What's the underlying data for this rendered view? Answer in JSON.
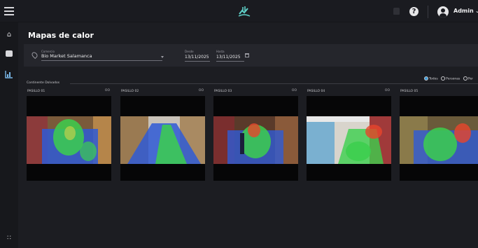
{
  "header": {
    "user_name": "Admin"
  },
  "page": {
    "title": "Mapas de calor"
  },
  "filters": {
    "store_label": "Comercio",
    "store_value": "Bio Market Salamanca",
    "from_label": "Desde",
    "from_value": "13/11/2025",
    "to_label": "Hasta",
    "to_value": "13/11/2025"
  },
  "options": {
    "items": [
      {
        "label": "Todos",
        "selected": true
      },
      {
        "label": "Personas",
        "selected": false
      },
      {
        "label": "Per",
        "selected": false
      }
    ]
  },
  "section": {
    "label": "Continente Dolvados"
  },
  "cameras": [
    {
      "name": "PASILLO 01",
      "flag": "OO"
    },
    {
      "name": "PASILLO 02",
      "flag": "OO"
    },
    {
      "name": "PASILLO 03",
      "flag": "OO"
    },
    {
      "name": "PASILLO 04",
      "flag": "OO"
    },
    {
      "name": "PASILLO 05",
      "flag": ""
    }
  ],
  "colors": {
    "accent": "#3a9bd9",
    "heat_low": "#2f5bd6",
    "heat_mid": "#3ccf4e",
    "heat_high": "#e8452c"
  },
  "icons": {
    "menu": "hamburger-icon",
    "logo": "brand-logo-icon",
    "bell": "bell-icon",
    "help": "help-icon",
    "user": "user-avatar-icon",
    "home": "home-icon",
    "camera": "camera-icon",
    "chart": "bar-chart-icon",
    "apps": "apps-grid-icon",
    "pin": "location-pin-icon",
    "calendar": "calendar-icon"
  }
}
